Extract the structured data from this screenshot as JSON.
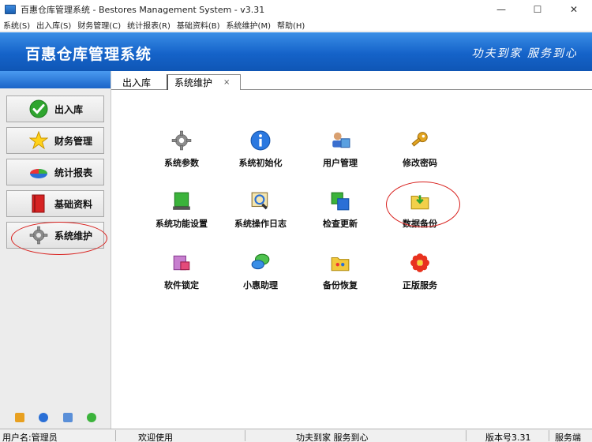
{
  "window": {
    "title": "百惠仓库管理系统 - Bestores Management System - v3.31",
    "controls": {
      "minimize": "—",
      "maximize": "☐",
      "close": "✕"
    }
  },
  "menu": [
    "系统(S)",
    "出入库(S)",
    "财务管理(C)",
    "统计报表(R)",
    "基础资料(B)",
    "系统维护(M)",
    "帮助(H)"
  ],
  "banner": {
    "title": "百惠仓库管理系统",
    "slogan": "功夫到家 服务到心"
  },
  "sidebar": {
    "items": [
      {
        "label": "出入库",
        "icon": "green-check-icon"
      },
      {
        "label": "财务管理",
        "icon": "star-icon"
      },
      {
        "label": "统计报表",
        "icon": "pie-chart-icon"
      },
      {
        "label": "基础资料",
        "icon": "book-icon"
      },
      {
        "label": "系统维护",
        "icon": "gear-icon",
        "highlighted": true
      }
    ],
    "bottom_icons": [
      "key-icon",
      "clock-icon",
      "monitor-icon",
      "globe-icon"
    ]
  },
  "tabs": [
    {
      "label": "出入库",
      "active": false
    },
    {
      "label": "系统维护",
      "active": true,
      "close": "×"
    }
  ],
  "tools": [
    {
      "label": "系统参数",
      "icon": "gear-icon"
    },
    {
      "label": "系统初始化",
      "icon": "info-icon"
    },
    {
      "label": "用户管理",
      "icon": "user-icon"
    },
    {
      "label": "修改密码",
      "icon": "key-icon"
    },
    {
      "label": "系统功能设置",
      "icon": "green-box-icon"
    },
    {
      "label": "系统操作日志",
      "icon": "log-icon"
    },
    {
      "label": "检查更新",
      "icon": "update-icon"
    },
    {
      "label": "数据备份",
      "icon": "folder-backup-icon",
      "highlighted": true
    },
    {
      "label": "软件锁定",
      "icon": "lock-icon"
    },
    {
      "label": "小惠助理",
      "icon": "chat-icon"
    },
    {
      "label": "备份恢复",
      "icon": "folder-restore-icon"
    },
    {
      "label": "正版服务",
      "icon": "flower-icon"
    }
  ],
  "status": {
    "user": "用户名:管理员",
    "welcome": "欢迎使用",
    "slogan": "功夫到家 服务到心",
    "version": "版本号3.31",
    "mode": "服务端"
  },
  "colors": {
    "banner": "#1563c9",
    "highlight_ring": "#d8201d"
  }
}
